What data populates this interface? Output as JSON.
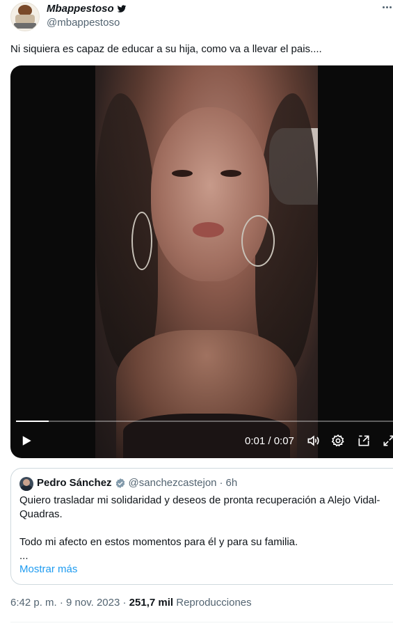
{
  "tweet": {
    "display_name": "Mbappestoso",
    "handle": "@mbappestoso",
    "text": "Ni siquiera es capaz de educar a su hija, como va a llevar el pais....",
    "timestamp": "6:42 p. m. · 9 nov. 2023",
    "separator": "·",
    "views_count": "251,7 mil",
    "views_label": "Reproducciones"
  },
  "video": {
    "time": "0:01 / 0:07",
    "progress_fraction": 0.085,
    "icons": [
      "play-icon",
      "volume-icon",
      "settings-icon",
      "pip-icon",
      "fullscreen-icon"
    ]
  },
  "quote": {
    "name": "Pedro Sánchez",
    "handle": "@sanchezcastejon",
    "dot": "·",
    "time": "6h",
    "lines": [
      "Quiero trasladar mi solidaridad y deseos de pronta recuperación a Alejo Vidal-",
      "Quadras.",
      "",
      "Todo mi afecto en estos momentos para él y para su familia.",
      "..."
    ],
    "show_more": "Mostrar más"
  },
  "colors": {
    "text": "#0f1419",
    "secondary": "#536471",
    "link": "#1d9bf0",
    "verified": "#829aab",
    "border": "#cfd9de"
  }
}
